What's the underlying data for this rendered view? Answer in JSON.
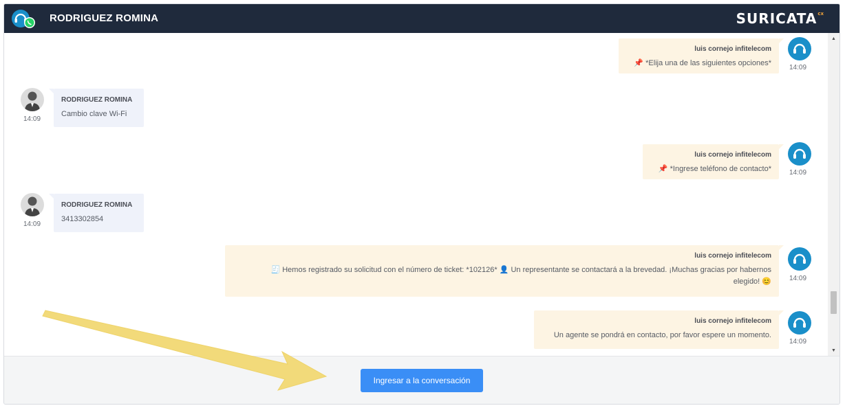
{
  "header": {
    "contact_name": "RODRIGUEZ ROMINA",
    "logo_text": "SURICATA",
    "logo_suffix": "cx"
  },
  "messages": [
    {
      "direction": "out",
      "sender": "luis cornejo infitelecom",
      "text": "📌 *Elija una de las siguientes opciones*",
      "time": "14:09"
    },
    {
      "direction": "in",
      "sender": "RODRIGUEZ ROMINA",
      "text": "Cambio clave Wi-Fi",
      "time": "14:09"
    },
    {
      "direction": "out",
      "sender": "luis cornejo infitelecom",
      "text": "📌 *Ingrese teléfono de contacto*",
      "time": "14:09"
    },
    {
      "direction": "in",
      "sender": "RODRIGUEZ ROMINA",
      "text": "3413302854",
      "time": "14:09"
    },
    {
      "direction": "out",
      "sender": "luis cornejo infitelecom",
      "text_line1": "🧾 Hemos registrado su solicitud con el número de ticket: *102126* 👤 Un representante se contactará a la brevedad. ¡Muchas gracias por habernos",
      "text_line2": "elegido! 😊",
      "time": "14:09"
    },
    {
      "direction": "out",
      "sender": "luis cornejo infitelecom",
      "text": "Un agente se pondrá en contacto, por favor espere un momento.",
      "time": "14:09"
    }
  ],
  "footer": {
    "join_button_label": "Ingresar a la conversación"
  },
  "colors": {
    "header_bg": "#1f2a3c",
    "agent_bubble": "#fdf4e3",
    "user_bubble": "#eff2fa",
    "agent_avatar": "#1a8fc9",
    "button": "#3a8ef6",
    "annotation_arrow": "#f2da7a",
    "whatsapp": "#25d366"
  }
}
